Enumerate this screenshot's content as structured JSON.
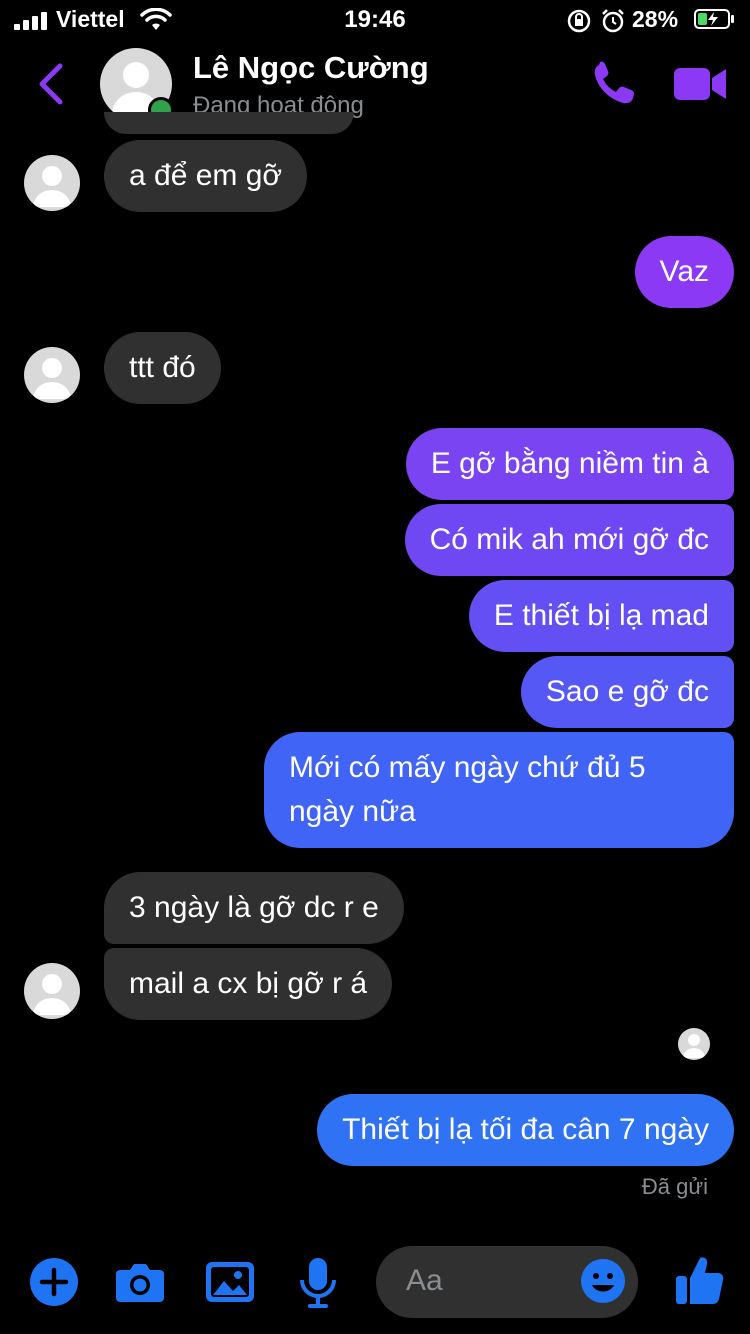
{
  "status_bar": {
    "carrier": "Viettel",
    "time": "19:46",
    "battery": "28%"
  },
  "header": {
    "name": "Lê Ngọc Cường",
    "status": "Đang hoạt động"
  },
  "messages": [
    {
      "from": "them",
      "text": "a để em gỡ"
    },
    {
      "from": "me",
      "text": "Vaz"
    },
    {
      "from": "them",
      "text": "ttt đó"
    },
    {
      "from": "me",
      "text": "E gỡ bằng niềm tin à"
    },
    {
      "from": "me",
      "text": "Có mik ah mới gỡ đc"
    },
    {
      "from": "me",
      "text": "E thiết bị lạ mad"
    },
    {
      "from": "me",
      "text": "Sao e gỡ đc"
    },
    {
      "from": "me",
      "text": "Mới có mấy ngày chứ đủ 5 ngày nữa"
    },
    {
      "from": "them",
      "text": "3 ngày là gỡ dc r e"
    },
    {
      "from": "them",
      "text": "mail a cx bị gỡ r á"
    },
    {
      "from": "me",
      "text": "Thiết bị lạ tối đa cân 7 ngày"
    }
  ],
  "delivery_status": "Đã gửi",
  "composer": {
    "placeholder": "Aa"
  },
  "colors": {
    "accent": "#8b39f5",
    "bubble_purple": "#7a44f2",
    "bubble_blue": "#3b6ef6",
    "incoming": "#303030",
    "icon_blue": "#1e74f3"
  },
  "icons": [
    "back-arrow-icon",
    "phone-icon",
    "video-camera-icon",
    "plus-icon",
    "camera-icon",
    "gallery-icon",
    "microphone-icon",
    "emoji-icon",
    "thumbs-up-icon"
  ]
}
